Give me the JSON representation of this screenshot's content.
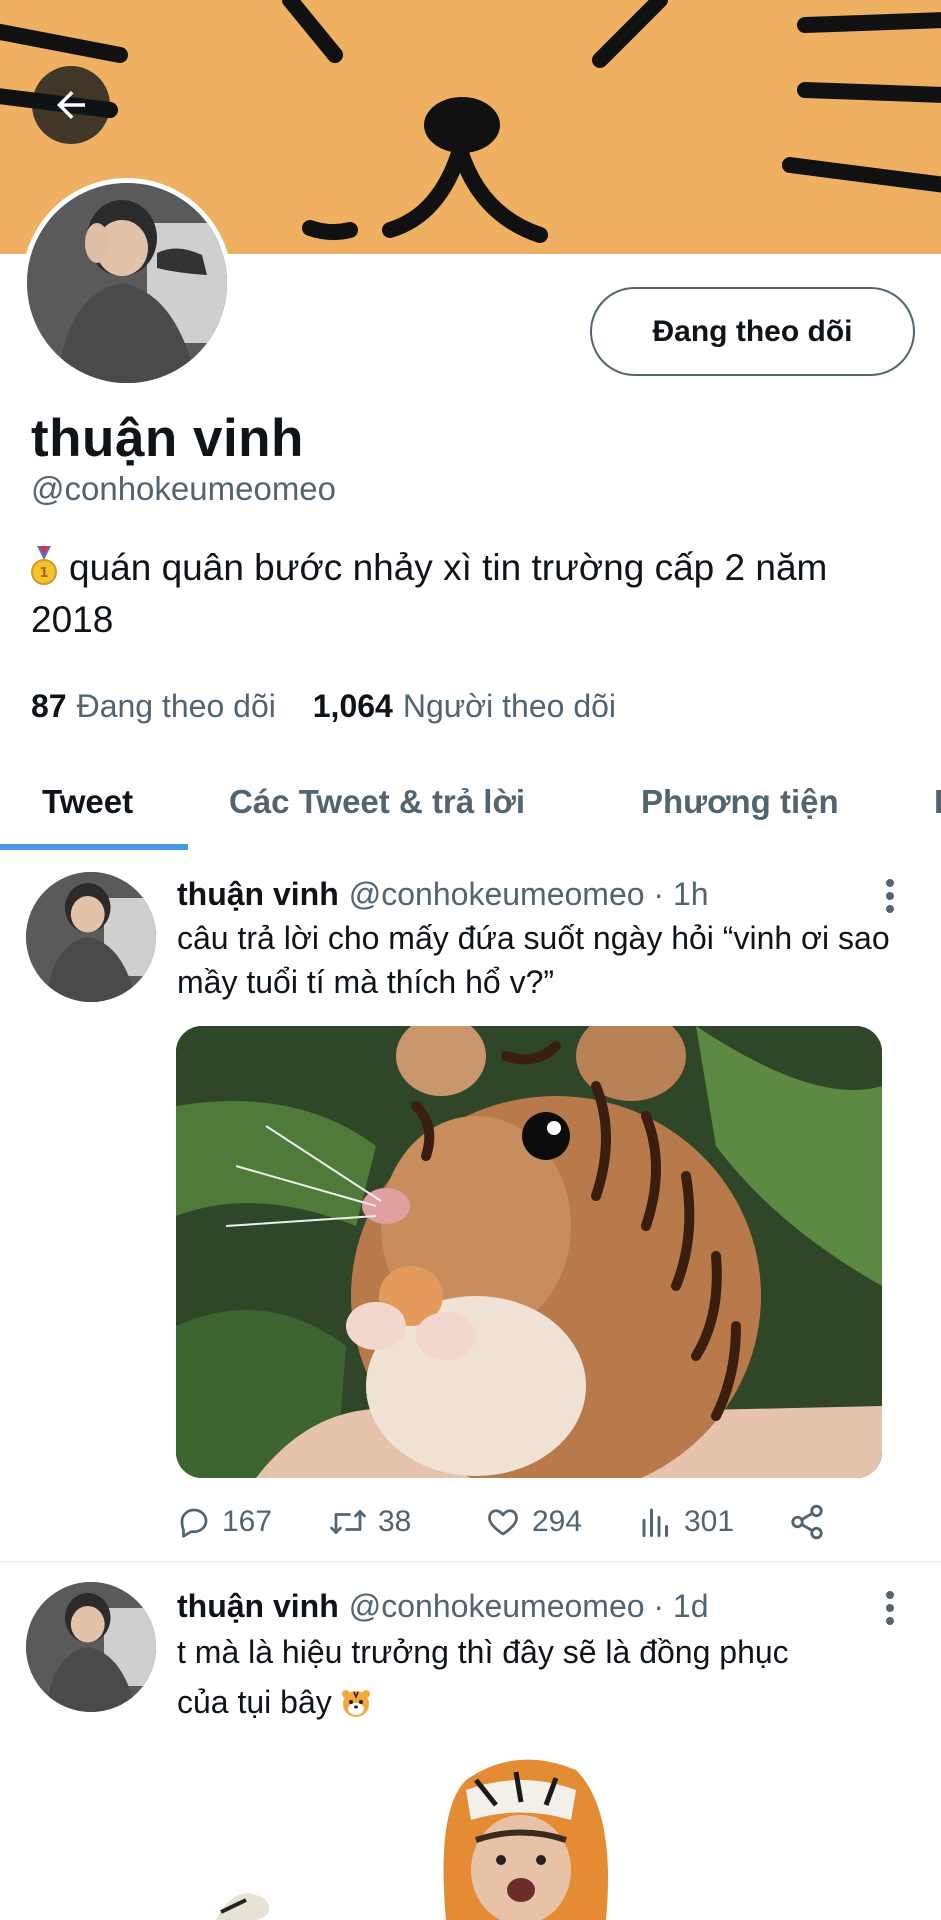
{
  "profile": {
    "display_name": "thuận vinh",
    "handle": "@conhokeumeomeo",
    "bio": "quán quân bước nhảy xì tin trường cấp 2 năm 2018",
    "following_button": "Đang theo dõi",
    "following_count": "87",
    "following_label": "Đang theo dõi",
    "followers_count": "1,064",
    "followers_label": "Người theo dõi",
    "banner_color": "#f0b062"
  },
  "tabs": [
    {
      "label": "Tweet",
      "active": true
    },
    {
      "label": "Các Tweet & trả lời",
      "active": false
    },
    {
      "label": "Phương tiện",
      "active": false
    }
  ],
  "tweets": [
    {
      "name": "thuận vinh",
      "handle_time": "@conhokeumeomeo · 1h",
      "text": "câu trả lời cho mấy đứa suốt ngày hỏi “vinh ơi sao mầy tuổi tí mà thích hổ v?”",
      "replies": "167",
      "retweets": "38",
      "likes": "294",
      "views": "301"
    },
    {
      "name": "thuận vinh",
      "handle_time": "@conhokeumeomeo · 1d",
      "text_line1": "t mà là hiệu trưởng thì đây sẽ là đồng phục",
      "text_line2": "của tụi bây"
    }
  ],
  "icons": {
    "back": "arrow-left-icon",
    "reply": "comment-icon",
    "retweet": "retweet-icon",
    "like": "heart-icon",
    "views": "bar-chart-icon",
    "share": "share-icon",
    "more": "more-vertical-icon",
    "medal": "medal-emoji",
    "tiger": "tiger-emoji"
  },
  "colors": {
    "accent": "#4a99e9",
    "secondary_text": "#536471"
  }
}
